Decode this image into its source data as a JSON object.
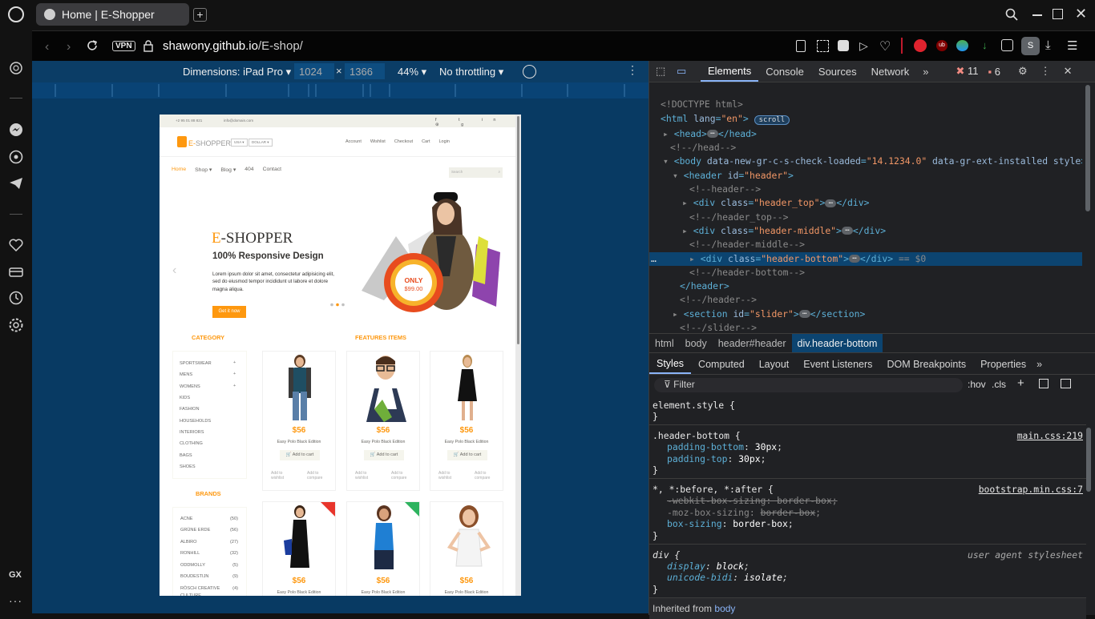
{
  "tab": {
    "title": "Home | E-Shopper"
  },
  "address_bar": {
    "vpn": "VPN",
    "url_host": "shawony.github.io",
    "url_path": "/E-shop/"
  },
  "sidebar": {
    "gx_label": "GX"
  },
  "device_toolbar": {
    "dimensions_label": "Dimensions: iPad Pro",
    "width": "1024",
    "times": "×",
    "height": "1366",
    "zoom": "44%",
    "throttling": "No throttling"
  },
  "site": {
    "phone": "+2 95 01 88 821",
    "email": "info@domain.com",
    "logo_e": "E-",
    "logo_rest": "SHOPPER",
    "currency1": "USA",
    "currency2": "DOLLAR",
    "top_links": [
      "Account",
      "Wishlist",
      "Checkout",
      "Cart",
      "Login"
    ],
    "nav": [
      "Home",
      "Shop",
      "Blog",
      "404",
      "Contact"
    ],
    "search_placeholder": "Search",
    "slider": {
      "title_e": "E",
      "title_rest": "-SHOPPER",
      "subtitle": "100% Responsive Design",
      "body": "Lorem ipsum dolor sit amet, consectetur adipisicing elit, sed do eiusmod tempor incididunt ut labore et dolore magna aliqua.",
      "button": "Get it now",
      "badge_top": "ONLY",
      "badge_price": "$99.00"
    },
    "category_heading": "CATEGORY",
    "categories": [
      "SPORTSWEAR",
      "MENS",
      "WOMENS",
      "KIDS",
      "FASHION",
      "HOUSEHOLDS",
      "INTERIORS",
      "CLOTHING",
      "BAGS",
      "SHOES"
    ],
    "brands_heading": "BRANDS",
    "brands": [
      {
        "name": "ACNE",
        "count": "(50)"
      },
      {
        "name": "GRÜNE ERDE",
        "count": "(56)"
      },
      {
        "name": "ALBIRO",
        "count": "(27)"
      },
      {
        "name": "RONHILL",
        "count": "(32)"
      },
      {
        "name": "ODDMOLLY",
        "count": "(5)"
      },
      {
        "name": "BOUDESTIJN",
        "count": "(9)"
      },
      {
        "name": "RÖSCH CREATIVE CULTURE",
        "count": "(4)"
      }
    ],
    "features_heading": "FEATURES ITEMS",
    "products": [
      {
        "price": "$56",
        "name": "Easy Polo Black Edition",
        "cart": "Add to cart",
        "wish": "Add to wishlist",
        "compare": "Add to compare"
      },
      {
        "price": "$56",
        "name": "Easy Polo Black Edition",
        "cart": "Add to cart",
        "wish": "Add to wishlist",
        "compare": "Add to compare"
      },
      {
        "price": "$56",
        "name": "Easy Polo Black Edition",
        "cart": "Add to cart",
        "wish": "Add to wishlist",
        "compare": "Add to compare"
      },
      {
        "price": "$56",
        "name": "Easy Polo Black Edition"
      },
      {
        "price": "$56",
        "name": "Easy Polo Black Edition"
      },
      {
        "price": "$56",
        "name": "Easy Polo Black Edition"
      }
    ]
  },
  "devtools": {
    "tabs": [
      "Elements",
      "Console",
      "Sources",
      "Network"
    ],
    "errors": "11",
    "warnings": "6",
    "dom": {
      "doctype": "<!DOCTYPE html>",
      "scroll_badge": "scroll",
      "eq_sel": "== $0"
    },
    "breadcrumbs": [
      "html",
      "body",
      "header#header",
      "div.header-bottom"
    ],
    "style_tabs": [
      "Styles",
      "Computed",
      "Layout",
      "Event Listeners",
      "DOM Breakpoints",
      "Properties"
    ],
    "filter_placeholder": "Filter",
    "hov": ":hov",
    "cls": ".cls",
    "rules": {
      "element_style": "element.style {",
      "r1_selector": ".header-bottom {",
      "r1_source": "main.css:219",
      "r2_selector": "*, *:before, *:after {",
      "r2_source": "bootstrap.min.css:7",
      "r3_selector": "div {",
      "r3_source": "user agent stylesheet",
      "inherited": "Inherited from",
      "inherited_el": "body"
    }
  },
  "colors": {
    "accent": "#fe980f",
    "devtools_bg": "#202124",
    "viewport_bg": "#083a63"
  }
}
